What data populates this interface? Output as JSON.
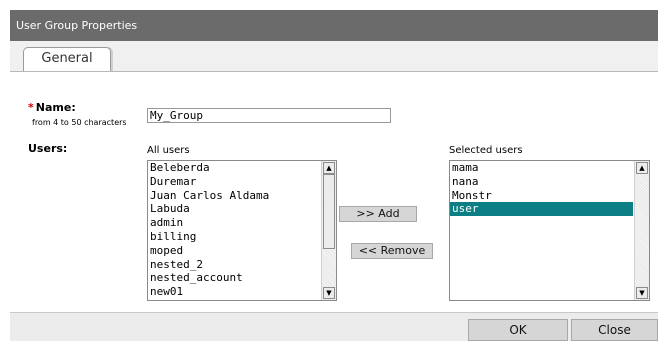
{
  "window": {
    "title": "User Group Properties"
  },
  "tabs": [
    {
      "label": "General",
      "active": true
    }
  ],
  "form": {
    "required_marker": "*",
    "name_label": "Name:",
    "name_hint": "from 4 to 50 characters",
    "name_value": "My_Group",
    "users_label": "Users:"
  },
  "all_users": {
    "caption": "All users",
    "items": [
      "Beleberda",
      "Duremar",
      "Juan Carlos Aldama",
      "Labuda",
      "admin",
      "billing",
      "moped",
      "nested_2",
      "nested_account",
      "new01"
    ]
  },
  "selected_users": {
    "caption": "Selected users",
    "items": [
      "mama",
      "nana",
      "Monstr",
      "user"
    ],
    "selected_item": "user"
  },
  "actions": {
    "add_label": ">> Add",
    "remove_label": "<< Remove"
  },
  "footer": {
    "ok_label": "OK",
    "close_label": "Close"
  },
  "colors": {
    "titlebar": "#6b6b6b",
    "selection": "#0b7f83",
    "required": "#cc0000"
  }
}
